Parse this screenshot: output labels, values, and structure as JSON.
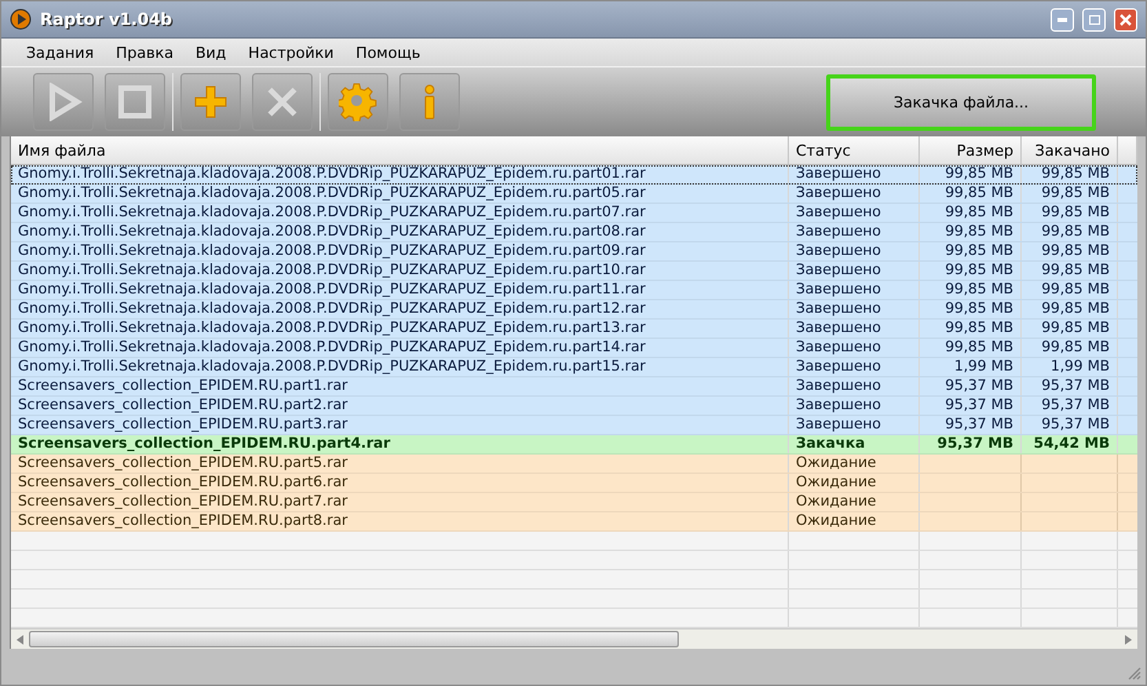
{
  "window": {
    "title": "Raptor v1.04b"
  },
  "menu": [
    "Задания",
    "Правка",
    "Вид",
    "Настройки",
    "Помощь"
  ],
  "toolbar": [
    {
      "kind": "play",
      "disabled": true
    },
    {
      "kind": "stop",
      "disabled": true
    },
    {
      "kind": "add",
      "disabled": false
    },
    {
      "kind": "delete",
      "disabled": true
    },
    {
      "kind": "settings",
      "disabled": false
    },
    {
      "kind": "info",
      "disabled": false
    }
  ],
  "status_button": {
    "label": "Закачка файла..."
  },
  "table": {
    "columns": [
      "Имя файла",
      "Статус",
      "Размер",
      "Закачано"
    ],
    "rows": [
      {
        "kind": "done",
        "selected": true,
        "name": "Gnomy.i.Trolli.Sekretnaja.kladovaja.2008.P.DVDRip_PUZKARAPUZ_Epidem.ru.part01.rar",
        "status": "Завершено",
        "size": "99,85 MB",
        "done": "99,85 MB"
      },
      {
        "kind": "done",
        "selected": false,
        "name": "Gnomy.i.Trolli.Sekretnaja.kladovaja.2008.P.DVDRip_PUZKARAPUZ_Epidem.ru.part05.rar",
        "status": "Завершено",
        "size": "99,85 MB",
        "done": "99,85 MB"
      },
      {
        "kind": "done",
        "selected": false,
        "name": "Gnomy.i.Trolli.Sekretnaja.kladovaja.2008.P.DVDRip_PUZKARAPUZ_Epidem.ru.part07.rar",
        "status": "Завершено",
        "size": "99,85 MB",
        "done": "99,85 MB"
      },
      {
        "kind": "done",
        "selected": false,
        "name": "Gnomy.i.Trolli.Sekretnaja.kladovaja.2008.P.DVDRip_PUZKARAPUZ_Epidem.ru.part08.rar",
        "status": "Завершено",
        "size": "99,85 MB",
        "done": "99,85 MB"
      },
      {
        "kind": "done",
        "selected": false,
        "name": "Gnomy.i.Trolli.Sekretnaja.kladovaja.2008.P.DVDRip_PUZKARAPUZ_Epidem.ru.part09.rar",
        "status": "Завершено",
        "size": "99,85 MB",
        "done": "99,85 MB"
      },
      {
        "kind": "done",
        "selected": false,
        "name": "Gnomy.i.Trolli.Sekretnaja.kladovaja.2008.P.DVDRip_PUZKARAPUZ_Epidem.ru.part10.rar",
        "status": "Завершено",
        "size": "99,85 MB",
        "done": "99,85 MB"
      },
      {
        "kind": "done",
        "selected": false,
        "name": "Gnomy.i.Trolli.Sekretnaja.kladovaja.2008.P.DVDRip_PUZKARAPUZ_Epidem.ru.part11.rar",
        "status": "Завершено",
        "size": "99,85 MB",
        "done": "99,85 MB"
      },
      {
        "kind": "done",
        "selected": false,
        "name": "Gnomy.i.Trolli.Sekretnaja.kladovaja.2008.P.DVDRip_PUZKARAPUZ_Epidem.ru.part12.rar",
        "status": "Завершено",
        "size": "99,85 MB",
        "done": "99,85 MB"
      },
      {
        "kind": "done",
        "selected": false,
        "name": "Gnomy.i.Trolli.Sekretnaja.kladovaja.2008.P.DVDRip_PUZKARAPUZ_Epidem.ru.part13.rar",
        "status": "Завершено",
        "size": "99,85 MB",
        "done": "99,85 MB"
      },
      {
        "kind": "done",
        "selected": false,
        "name": "Gnomy.i.Trolli.Sekretnaja.kladovaja.2008.P.DVDRip_PUZKARAPUZ_Epidem.ru.part14.rar",
        "status": "Завершено",
        "size": "99,85 MB",
        "done": "99,85 MB"
      },
      {
        "kind": "done",
        "selected": false,
        "name": "Gnomy.i.Trolli.Sekretnaja.kladovaja.2008.P.DVDRip_PUZKARAPUZ_Epidem.ru.part15.rar",
        "status": "Завершено",
        "size": "1,99 MB",
        "done": "1,99 MB"
      },
      {
        "kind": "done",
        "selected": false,
        "name": "Screensavers_collection_EPIDEM.RU.part1.rar",
        "status": "Завершено",
        "size": "95,37 MB",
        "done": "95,37 MB"
      },
      {
        "kind": "done",
        "selected": false,
        "name": "Screensavers_collection_EPIDEM.RU.part2.rar",
        "status": "Завершено",
        "size": "95,37 MB",
        "done": "95,37 MB"
      },
      {
        "kind": "done",
        "selected": false,
        "name": "Screensavers_collection_EPIDEM.RU.part3.rar",
        "status": "Завершено",
        "size": "95,37 MB",
        "done": "95,37 MB"
      },
      {
        "kind": "active",
        "selected": false,
        "name": "Screensavers_collection_EPIDEM.RU.part4.rar",
        "status": "Закачка",
        "size": "95,37 MB",
        "done": "54,42 MB"
      },
      {
        "kind": "waiting",
        "selected": false,
        "name": "Screensavers_collection_EPIDEM.RU.part5.rar",
        "status": "Ожидание"
      },
      {
        "kind": "waiting",
        "selected": false,
        "name": "Screensavers_collection_EPIDEM.RU.part6.rar",
        "status": "Ожидание"
      },
      {
        "kind": "waiting",
        "selected": false,
        "name": "Screensavers_collection_EPIDEM.RU.part7.rar",
        "status": "Ожидание"
      },
      {
        "kind": "waiting",
        "selected": false,
        "name": "Screensavers_collection_EPIDEM.RU.part8.rar",
        "status": "Ожидание"
      }
    ]
  }
}
